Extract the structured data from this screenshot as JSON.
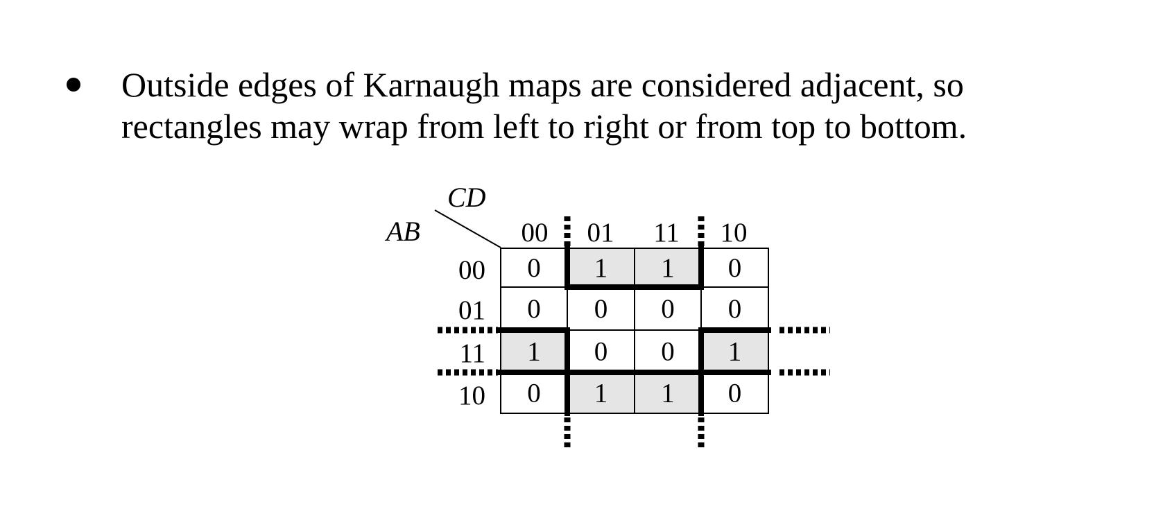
{
  "bullet": {
    "line1": "Outside edges of Karnaugh maps are considered adjacent, so",
    "line2": "rectangles may wrap from left to right or from top to bottom."
  },
  "kmap": {
    "col_var": "CD",
    "row_var": "AB",
    "col_labels": [
      "00",
      "01",
      "11",
      "10"
    ],
    "row_labels": [
      "00",
      "01",
      "11",
      "10"
    ],
    "cells": [
      [
        "0",
        "1",
        "1",
        "0"
      ],
      [
        "0",
        "0",
        "0",
        "0"
      ],
      [
        "1",
        "0",
        "0",
        "1"
      ],
      [
        "0",
        "1",
        "1",
        "0"
      ]
    ],
    "highlighted": [
      [
        false,
        true,
        true,
        false
      ],
      [
        false,
        false,
        false,
        false
      ],
      [
        true,
        false,
        false,
        true
      ],
      [
        false,
        true,
        true,
        false
      ]
    ],
    "colors": {
      "highlight_fill": "#e5e5e5",
      "line": "#000000"
    }
  }
}
